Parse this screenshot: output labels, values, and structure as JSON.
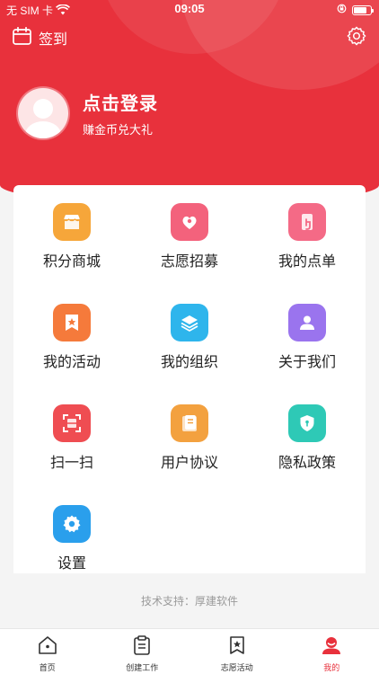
{
  "status_bar": {
    "carrier": "无 SIM 卡",
    "time": "09:05",
    "battery_level": 0.8
  },
  "header": {
    "signin_label": "签到",
    "signin_icon": "calendar-icon",
    "settings_icon": "gear-icon"
  },
  "profile": {
    "title": "点击登录",
    "subtitle": "赚金币兑大礼"
  },
  "menu": {
    "items": [
      {
        "label": "积分商城",
        "icon": "store-icon",
        "color": "#f6a63a"
      },
      {
        "label": "志愿招募",
        "icon": "volunteer-heart-icon",
        "color": "#f3627c"
      },
      {
        "label": "我的点单",
        "icon": "tap-order-icon",
        "color": "#f46a86"
      },
      {
        "label": "我的活动",
        "icon": "star-bookmark-icon",
        "color": "#f57a3b"
      },
      {
        "label": "我的组织",
        "icon": "layers-icon",
        "color": "#2eb5ec"
      },
      {
        "label": "关于我们",
        "icon": "person-icon",
        "color": "#9a74ee"
      },
      {
        "label": "扫一扫",
        "icon": "scan-icon",
        "color": "#ef4d52"
      },
      {
        "label": "用户协议",
        "icon": "document-icon",
        "color": "#f3a13f"
      },
      {
        "label": "隐私政策",
        "icon": "shield-icon",
        "color": "#2ec9b6"
      },
      {
        "label": "设置",
        "icon": "gear-icon",
        "color": "#2a9fec"
      }
    ]
  },
  "footer": {
    "support_text": "技术支持：厚建软件"
  },
  "tabbar": {
    "tabs": [
      {
        "label": "首页",
        "icon": "home-icon"
      },
      {
        "label": "创建工作",
        "icon": "clipboard-icon"
      },
      {
        "label": "志愿活动",
        "icon": "bookmark-star-icon"
      },
      {
        "label": "我的",
        "icon": "user-icon",
        "active": true
      }
    ]
  },
  "colors": {
    "brand": "#e8313c"
  }
}
